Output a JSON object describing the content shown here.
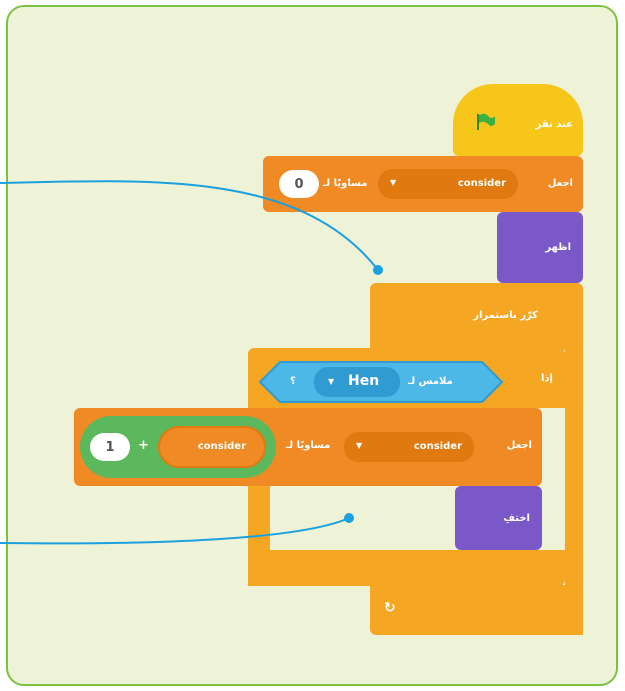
{
  "hat_block": {
    "label": "عند نقر",
    "icon": "green-flag-icon"
  },
  "set_block_1": {
    "action_label": "اجعل",
    "variable_label": "consider",
    "dropdown_arrow": "▼",
    "to_label": "مساويًا لـ",
    "value": "0"
  },
  "show_block": {
    "label": "اظهر"
  },
  "forever_block": {
    "label": "كرّر باستمرار",
    "repeat_arrow": "↻"
  },
  "if_block": {
    "if_label": "إذا",
    "sensing": {
      "touching_label": "ملامس لـ",
      "target": "Hen",
      "dropdown_arrow": "▼",
      "question_mark": "؟"
    }
  },
  "set_block_2": {
    "action_label": "اجعل",
    "variable_label": "consider",
    "dropdown_arrow": "▼",
    "to_label": "مساويًا لـ",
    "operand_variable": "consider",
    "operator": "+",
    "operand_value": "1"
  },
  "hide_block": {
    "label": "اختفِ"
  },
  "colors": {
    "frame_bg": "#eef3d8",
    "frame_border": "#7cc242",
    "events": "#f7c61a",
    "variables": "#f08a24",
    "looks": "#7b58c8",
    "control": "#f5a623",
    "sensing": "#4db8e8",
    "operators": "#5cb85c",
    "callout_line": "#1aa0de"
  }
}
